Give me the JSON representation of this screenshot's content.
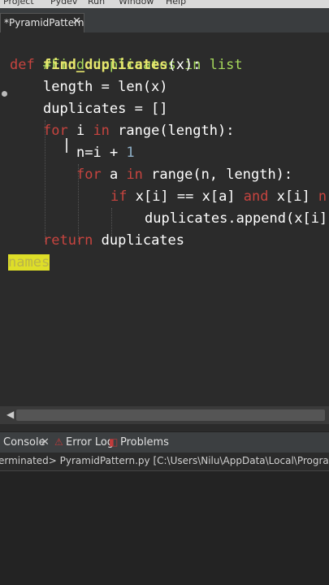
{
  "menubar": {
    "items": [
      "Project",
      "Pydev",
      "Run",
      "Window",
      "Help"
    ]
  },
  "editor_tab": {
    "label": "*PyramidPattern",
    "close": "✕"
  },
  "code": {
    "l1": "#Find duplicates in list",
    "l2_kw": "def",
    "l2_fn": "find_duplicates",
    "l2_rest": "(x):",
    "l3": "length = len(x)",
    "l4": "duplicates = []",
    "l5_kw1": "for",
    "l5_a": " i ",
    "l5_kw2": "in",
    "l5_b": " range(length):",
    "l6_a": "n=i + ",
    "l6_num": "1",
    "l7_kw1": "for",
    "l7_a": " a ",
    "l7_kw2": "in",
    "l7_b": " range(n, length):",
    "l8_kw1": "if",
    "l8_a": " x[i] == x[a] ",
    "l8_kw2": "and",
    "l8_b": " x[i] ",
    "l8_kw3": "n",
    "l9": "duplicates.append(x[i]",
    "l10_kw": "return",
    "l10_b": " duplicates",
    "l11": "names"
  },
  "console": {
    "tabs": [
      {
        "label": "Console",
        "close": "✕"
      },
      {
        "label": "Error Log"
      },
      {
        "label": "Problems"
      }
    ],
    "status": "erminated> PyramidPattern.py [C:\\Users\\Nilu\\AppData\\Local\\Programs\\Python\\Py"
  },
  "colors": {
    "keyword": "#c7443f",
    "function": "#e7e66d",
    "comment": "#a6d95b",
    "selection": "#dede28"
  }
}
